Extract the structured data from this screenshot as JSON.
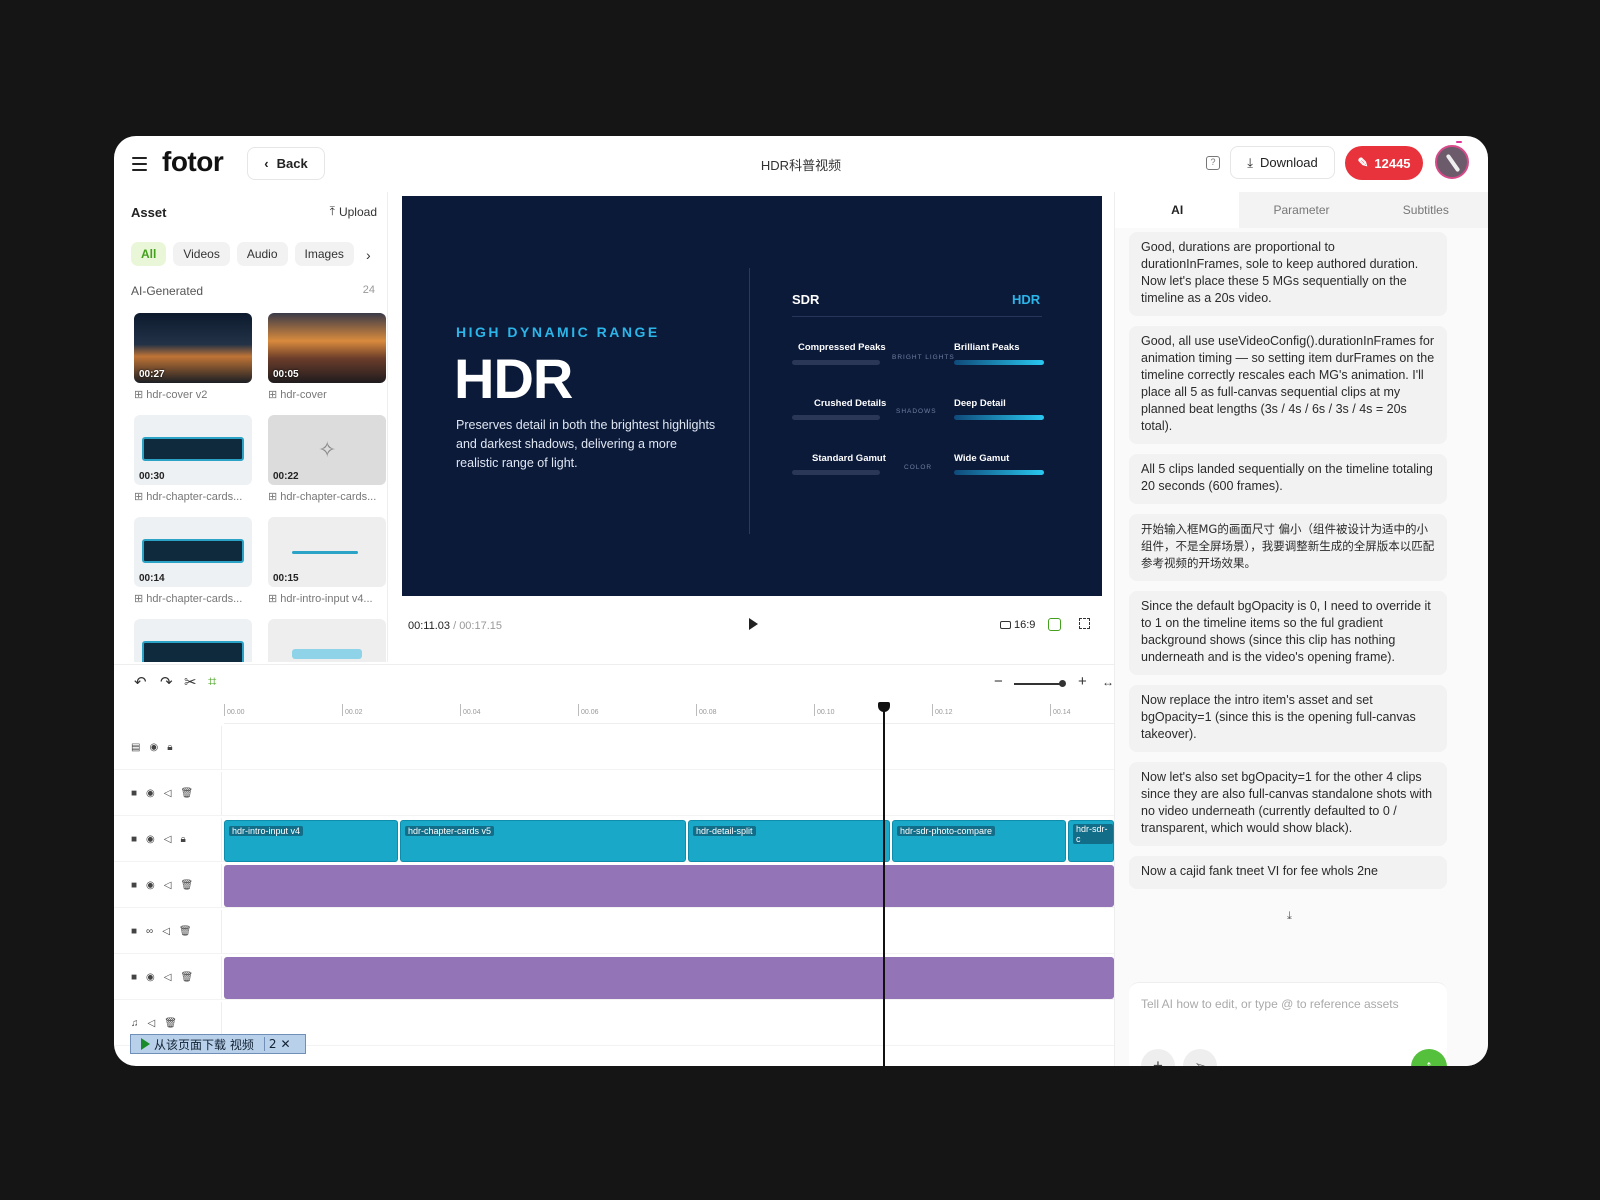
{
  "header": {
    "logo": "fotor",
    "back_label": "Back",
    "project_title": "HDR科普视频",
    "download_label": "Download",
    "credits": "12445"
  },
  "assets": {
    "title": "Asset",
    "upload_label": "Upload",
    "filters": [
      "All",
      "Videos",
      "Audio",
      "Images"
    ],
    "section_title": "AI-Generated",
    "section_count": "24",
    "items": [
      {
        "duration": "00:27",
        "caption": "hdr-cover v2"
      },
      {
        "duration": "00:05",
        "caption": "hdr-cover"
      },
      {
        "duration": "00:30",
        "caption": "hdr-chapter-cards..."
      },
      {
        "duration": "00:22",
        "caption": "hdr-chapter-cards..."
      },
      {
        "duration": "00:14",
        "caption": "hdr-chapter-cards..."
      },
      {
        "duration": "00:15",
        "caption": "hdr-intro-input v4..."
      }
    ]
  },
  "preview": {
    "kicker": "HIGH DYNAMIC RANGE",
    "title": "HDR",
    "description": "Preserves detail in both the brightest highlights and darkest shadows, delivering a more realistic range of light.",
    "sdr_label": "SDR",
    "hdr_label": "HDR",
    "rows": [
      {
        "sdr": "Compressed Peaks",
        "middle": "BRIGHT LIGHTS",
        "hdr": "Brilliant Peaks"
      },
      {
        "sdr": "Crushed Details",
        "middle": "SHADOWS",
        "hdr": "Deep Detail"
      },
      {
        "sdr": "Standard Gamut",
        "middle": "COLOR",
        "hdr": "Wide Gamut"
      }
    ]
  },
  "playback": {
    "current_time": "00:11.03",
    "total_time": "/ 00:17.15",
    "aspect_ratio": "16:9"
  },
  "timeline": {
    "ticks": [
      "00.00",
      "00.02",
      "00.04",
      "00.06",
      "00.08",
      "00.10",
      "00.12",
      "00.14"
    ],
    "clips": [
      "hdr-intro-input v4",
      "hdr-chapter-cards v5",
      "hdr-detail-split",
      "hdr-sdr-photo-compare",
      "hdr-sdr-c"
    ]
  },
  "download_bar": {
    "label": "从该页面下载 视频",
    "count": "2",
    "close": "✕"
  },
  "ai_panel": {
    "tabs": [
      "AI",
      "Parameter",
      "Subtitles"
    ],
    "messages": [
      "Good, durations are proportional to durationInFrames, sole to keep authored duration. Now let's place these 5 MGs sequentially on the timeline as a 20s video.",
      "Good, all use useVideoConfig().durationInFrames for animation timing — so setting item durFrames on the timeline correctly rescales each MG's animation. I'll place all 5 as full-canvas sequential clips at my planned beat lengths (3s / 4s / 6s / 3s / 4s = 20s total).",
      "All 5 clips landed sequentially on the timeline totaling 20 seconds (600 frames).",
      "开始输入框MG的画面尺寸 偏小（组件被设计为适中的小组件，不是全屏场景），我要调整新生成的全屏版本以匹配参考视频的开场效果。",
      "Since the default  bgOpacity is 0, I need to override it to 1 on the timeline items so the ful gradient background shows (since this clip has nothing underneath and is the video's opening frame).",
      "Now replace the intro item's asset and set bgOpacity=1 (since this is the opening full-canvas takeover).",
      "Now let's also set bgOpacity=1 for the other 4 clips since they are also full-canvas standalone shots with no video underneath (currently defaulted to 0 / transparent, which would show black).",
      "Now a cajid fank tneet VI for fee whols 2ne"
    ],
    "input_placeholder": "Tell AI how to edit, or type @ to reference assets"
  },
  "colors": {
    "accent_green": "#55c03b",
    "credits_red": "#e8323c",
    "clip_blue": "#1aa8c8",
    "clip_purple": "#9274b7",
    "preview_bg": "#0c1a3a",
    "hdr_cyan": "#2bb5e8"
  }
}
